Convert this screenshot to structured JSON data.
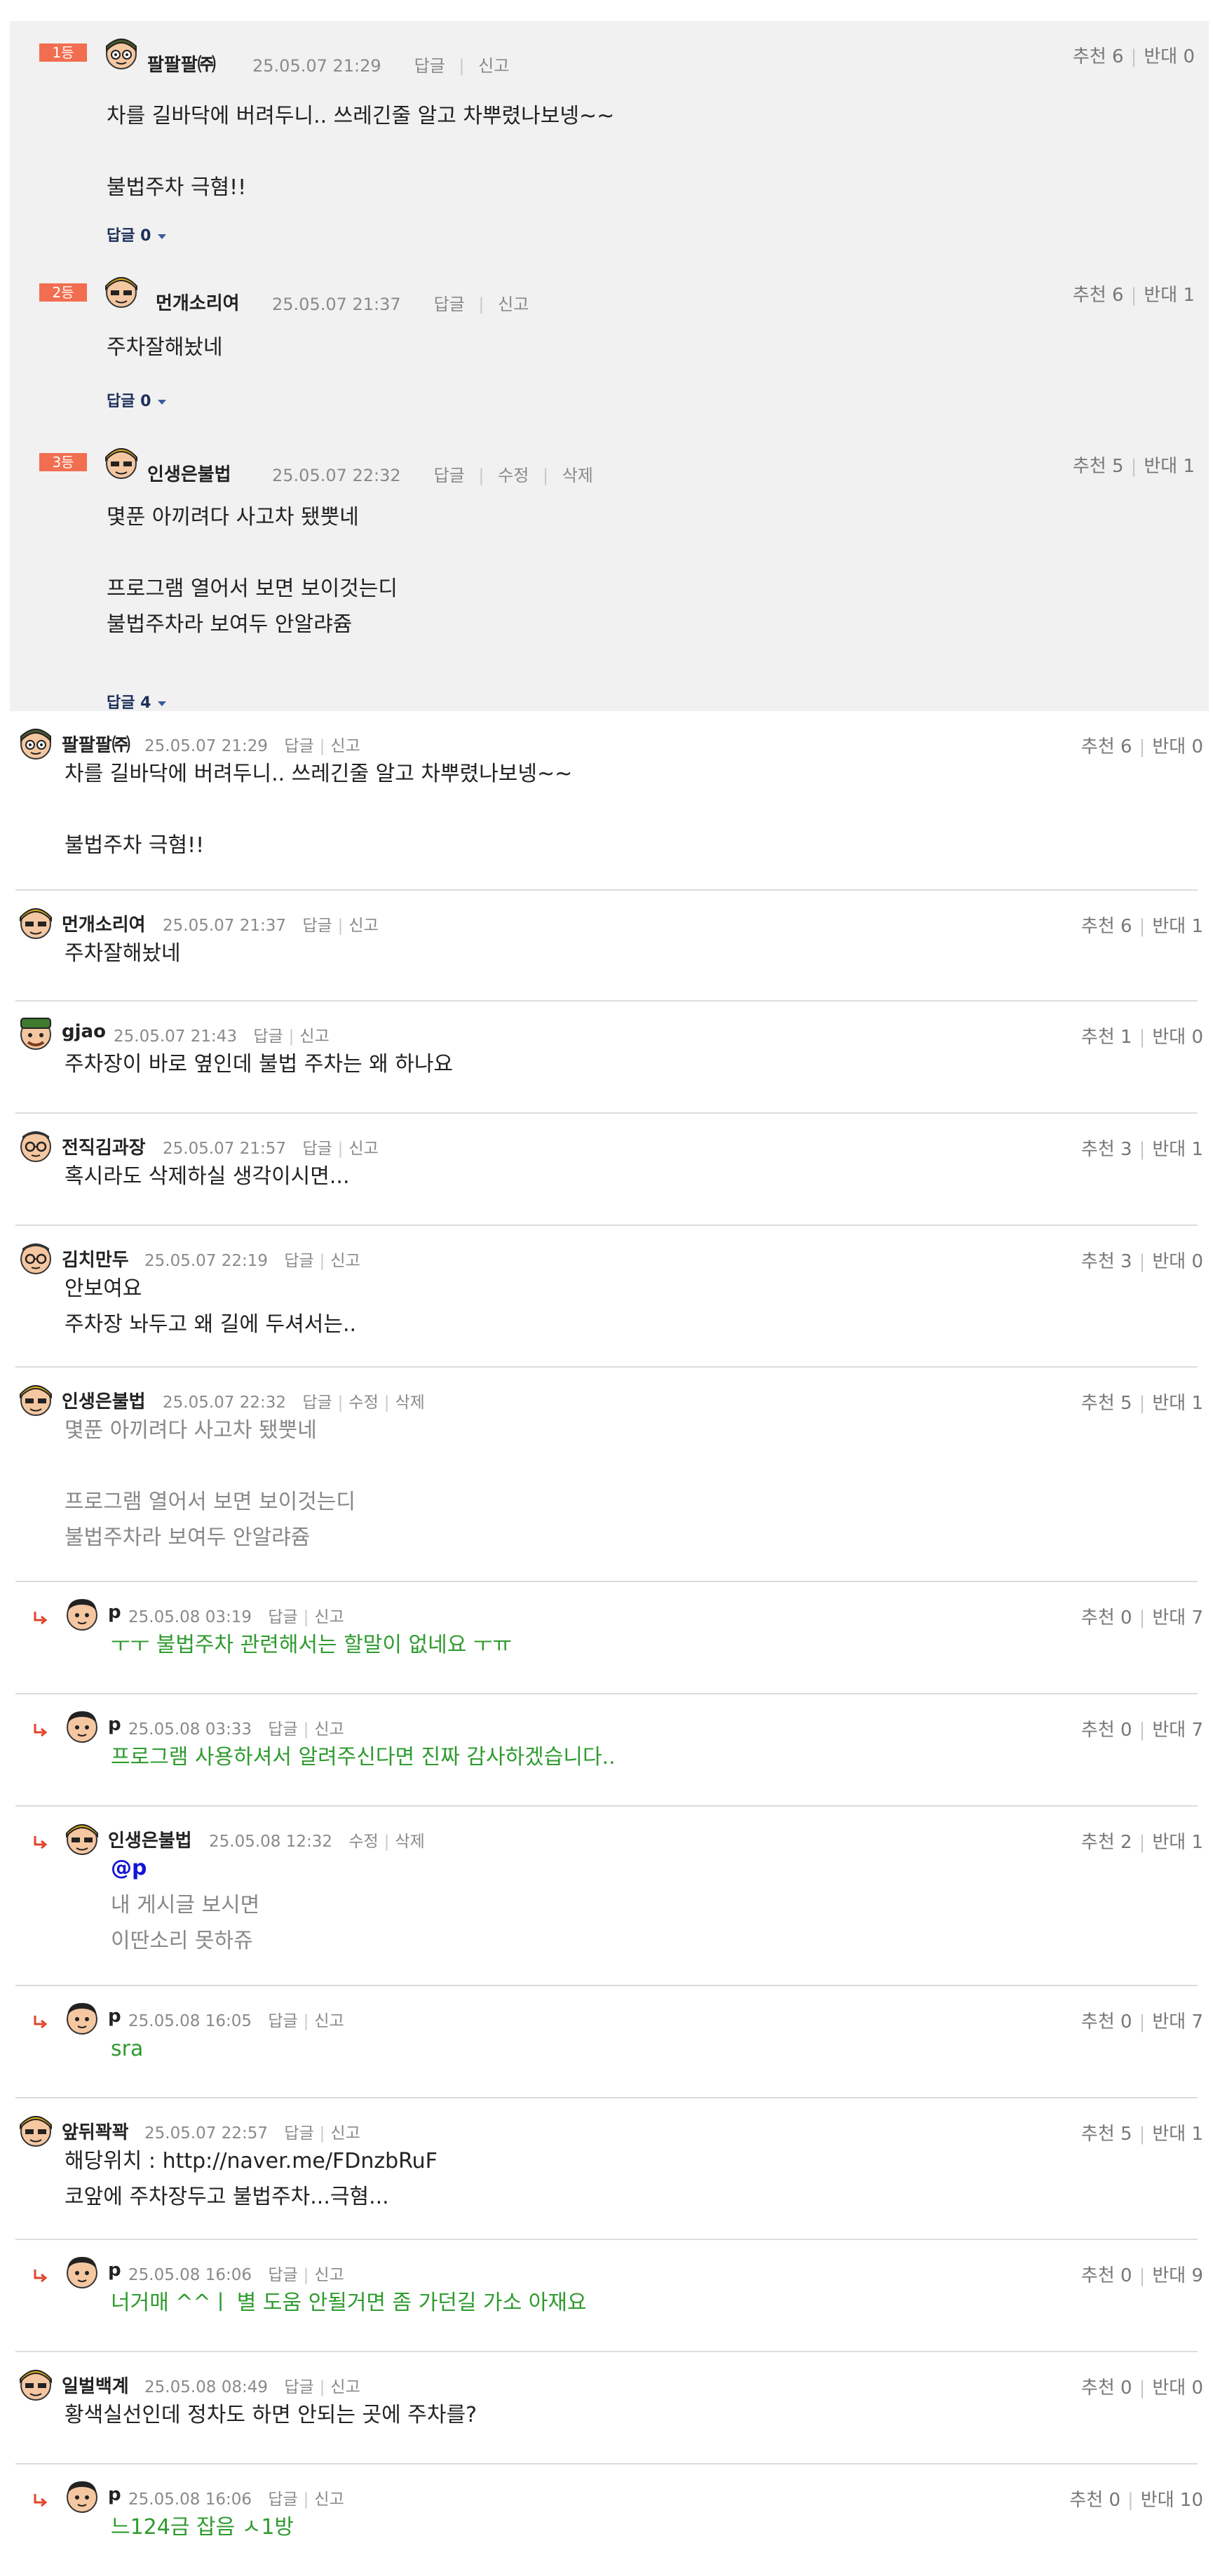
{
  "labels": {
    "reply": "답글",
    "report": "신고",
    "edit": "수정",
    "delete": "삭제",
    "recommend": "추천",
    "oppose": "반대"
  },
  "best": [
    {
      "rank": "1등",
      "author": "팔팔팔㈜",
      "date": "25.05.07 21:29",
      "actions": [
        "답글",
        "신고"
      ],
      "up": "6",
      "down": "0",
      "text": "차를 길바닥에 버려두니.. 쓰레긴줄 알고 차뿌렸나보넹~~\n\n불법주차 극혐!!",
      "replies": "답글 0"
    },
    {
      "rank": "2등",
      "author": "먼개소리여",
      "date": "25.05.07 21:37",
      "actions": [
        "답글",
        "신고"
      ],
      "up": "6",
      "down": "1",
      "text": "주차잘해놨네",
      "replies": "답글 0"
    },
    {
      "rank": "3등",
      "author": "인생은불법",
      "date": "25.05.07 22:32",
      "actions": [
        "답글",
        "수정",
        "삭제"
      ],
      "up": "5",
      "down": "1",
      "text": "몇푼 아끼려다 사고차 됐뿟네\n\n프로그램 열어서 보면 보이것는디\n불법주차라 보여두 안알랴쥼",
      "replies": "답글 4"
    }
  ],
  "comments": [
    {
      "author": "팔팔팔㈜",
      "date": "25.05.07 21:29",
      "actions": [
        "답글",
        "신고"
      ],
      "up": "6",
      "down": "0",
      "text": "차를 길바닥에 버려두니.. 쓰레긴줄 알고 차뿌렸나보넹~~\n\n불법주차 극혐!!"
    },
    {
      "author": "먼개소리여",
      "date": "25.05.07 21:37",
      "actions": [
        "답글",
        "신고"
      ],
      "up": "6",
      "down": "1",
      "text": "주차잘해놨네"
    },
    {
      "author": "gjao",
      "date": "25.05.07 21:43",
      "actions": [
        "답글",
        "신고"
      ],
      "up": "1",
      "down": "0",
      "text": "주차장이 바로 옆인데 불법 주차는 왜 하나요"
    },
    {
      "author": "전직김과장",
      "date": "25.05.07 21:57",
      "actions": [
        "답글",
        "신고"
      ],
      "up": "3",
      "down": "1",
      "text": "혹시라도 삭제하실 생각이시면..."
    },
    {
      "author": "김치만두",
      "date": "25.05.07 22:19",
      "actions": [
        "답글",
        "신고"
      ],
      "up": "3",
      "down": "0",
      "text": "안보여요\n주차장 놔두고 왜 길에 두셔서는.."
    },
    {
      "author": "인생은불법",
      "date": "25.05.07 22:32",
      "actions": [
        "답글",
        "수정",
        "삭제"
      ],
      "up": "5",
      "down": "1",
      "text": "몇푼 아끼려다 사고차 됐뿟네\n\n프로그램 열어서 보면 보이것는디\n불법주차라 보여두 안알랴쥼"
    },
    {
      "author": "p",
      "date": "25.05.08 03:19",
      "actions": [
        "답글",
        "신고"
      ],
      "up": "0",
      "down": "7",
      "text": "ㅜㅜ 불법주차 관련해서는 할말이 없네요 ㅜㅠ"
    },
    {
      "author": "p",
      "date": "25.05.08 03:33",
      "actions": [
        "답글",
        "신고"
      ],
      "up": "0",
      "down": "7",
      "text": "프로그램 사용하셔서 알려주신다면 진짜 감사하겠습니다.."
    },
    {
      "author": "인생은불법",
      "date": "25.05.08 12:32",
      "actions": [
        "수정",
        "삭제"
      ],
      "up": "2",
      "down": "1",
      "mention": "@p",
      "text": "내 게시글 보시면\n이딴소리 못하쥬"
    },
    {
      "author": "p",
      "date": "25.05.08 16:05",
      "actions": [
        "답글",
        "신고"
      ],
      "up": "0",
      "down": "7",
      "text": "sra"
    },
    {
      "author": "앞뒤꽉꽉",
      "date": "25.05.07 22:57",
      "actions": [
        "답글",
        "신고"
      ],
      "up": "5",
      "down": "1",
      "text": "해당위치 : http://naver.me/FDnzbRuF\n코앞에 주차장두고 불법주차...극혐..."
    },
    {
      "author": "p",
      "date": "25.05.08 16:06",
      "actions": [
        "답글",
        "신고"
      ],
      "up": "0",
      "down": "9",
      "text": "너거매 ^^ㅣ 별 도움 안될거면 좀 가던길 가소 아재요"
    },
    {
      "author": "일벌백계",
      "date": "25.05.08 08:49",
      "actions": [
        "답글",
        "신고"
      ],
      "up": "0",
      "down": "0",
      "text": "황색실선인데 정차도 하면 안되는 곳에 주차를?"
    },
    {
      "author": "p",
      "date": "25.05.08 16:06",
      "actions": [
        "답글",
        "신고"
      ],
      "up": "0",
      "down": "10",
      "text": "느124금 잡음 ㅅ1방"
    }
  ]
}
